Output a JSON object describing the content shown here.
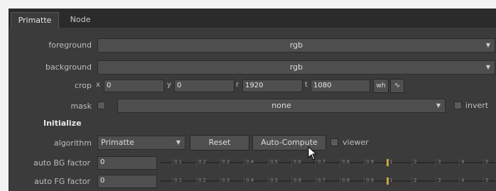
{
  "tabs": [
    {
      "label": "Primatte",
      "active": true
    },
    {
      "label": "Node",
      "active": false
    }
  ],
  "foreground": {
    "label": "foreground",
    "value": "rgb"
  },
  "background": {
    "label": "background",
    "value": "rgb"
  },
  "crop": {
    "label": "crop",
    "x_label": "x",
    "x": "0",
    "y_label": "y",
    "y": "0",
    "r_label": "r",
    "r": "1920",
    "t_label": "t",
    "t": "1080",
    "wh_label": "wh"
  },
  "mask": {
    "label": "mask",
    "value": "none",
    "invert_label": "invert"
  },
  "initialize": {
    "title": "Initialize"
  },
  "algorithm": {
    "label": "algorithm",
    "value": "Primatte"
  },
  "buttons": {
    "reset": "Reset",
    "auto_compute": "Auto-Compute",
    "viewer_label": "viewer"
  },
  "auto_bg": {
    "label": "auto BG factor",
    "value": "0"
  },
  "auto_fg": {
    "label": "auto FG factor",
    "value": "0"
  },
  "slider_ticks": [
    "0.1",
    "0.2",
    "0.3",
    "0.4",
    "0.5",
    "0.6",
    "0.7",
    "0.8",
    "0.9",
    "1",
    "2",
    "3",
    "4",
    "5"
  ],
  "colors": {
    "panel": "#3b3b3b",
    "field": "#4e4e4e",
    "marker": "#c7a64a"
  }
}
